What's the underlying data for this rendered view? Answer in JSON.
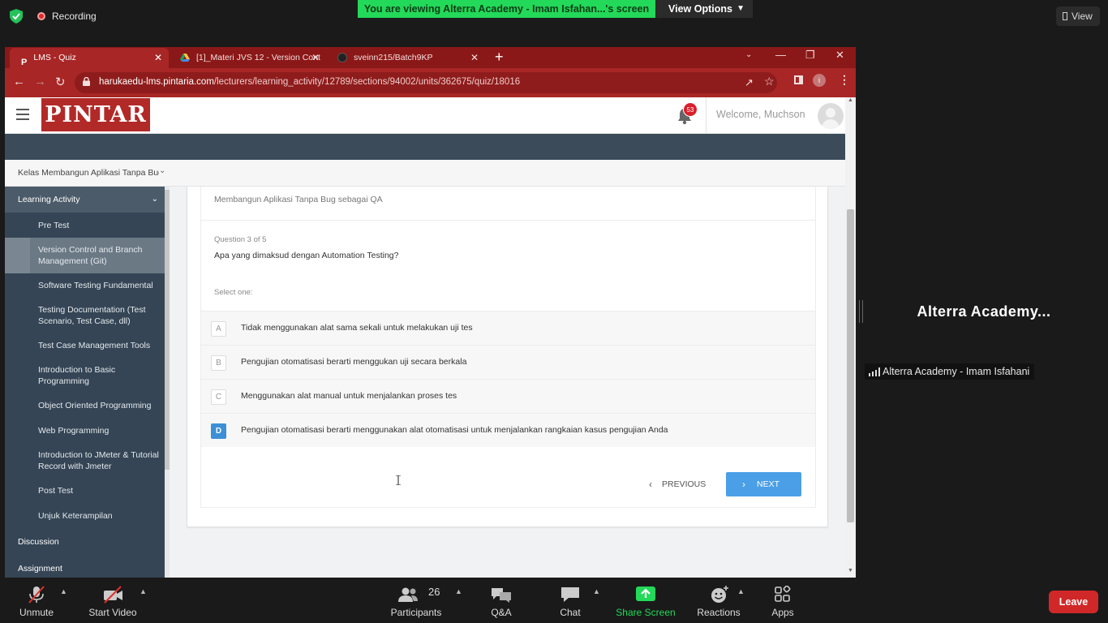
{
  "zoom_top": {
    "recording_label": "Recording",
    "viewing_banner": "You are viewing Alterra Academy - Imam Isfahan...'s screen",
    "view_options_label": "View Options",
    "view_label": "View"
  },
  "browser": {
    "tabs": [
      {
        "label": "LMS - Quiz"
      },
      {
        "label": "[1]_Materi JVS 12 - Version Cont"
      },
      {
        "label": "sveinn215/Batch9KP"
      }
    ],
    "url_host": "harukaedu-lms.pintaria.com",
    "url_path": "/lecturers/learning_activity/12789/sections/94002/units/362675/quiz/18016",
    "theme_color": "#a82626"
  },
  "header": {
    "logo_text": "PINTAR",
    "notification_count": "53",
    "welcome_text": "Welcome, Muchson"
  },
  "course": {
    "title": "Kelas Membangun Aplikasi Tanpa Bug sebagai QA"
  },
  "sidebar": {
    "section_learning_activity": "Learning Activity",
    "items": [
      {
        "label": "Pre Test"
      },
      {
        "label": "Version Control and Branch Management (Git)"
      },
      {
        "label": "Software Testing Fundamental"
      },
      {
        "label": "Testing Documentation (Test Scenario, Test Case, dll)"
      },
      {
        "label": "Test Case Management Tools"
      },
      {
        "label": "Introduction to Basic Programming"
      },
      {
        "label": "Object Oriented Programming"
      },
      {
        "label": "Web Programming"
      },
      {
        "label": "Introduction to JMeter & Tutorial Record with Jmeter"
      },
      {
        "label": "Post Test"
      },
      {
        "label": "Unjuk Keterampilan"
      }
    ],
    "section_discussion": "Discussion",
    "section_assignment": "Assignment"
  },
  "quiz": {
    "title": "Membangun Aplikasi Tanpa Bug sebagai QA",
    "question_number": "Question 3 of 5",
    "question_text": "Apa yang dimaksud dengan Automation Testing?",
    "select_one": "Select one:",
    "options": [
      {
        "letter": "A",
        "text": "Tidak menggunakan alat sama sekali untuk melakukan uji tes",
        "selected": false
      },
      {
        "letter": "B",
        "text": "Pengujian otomatisasi berarti menggukan uji secara berkala",
        "selected": false
      },
      {
        "letter": "C",
        "text": "Menggunakan alat manual untuk menjalankan proses tes",
        "selected": false
      },
      {
        "letter": "D",
        "text": "Pengujian otomatisasi berarti menggunakan alat otomatisasi untuk menjalankan rangkaian kasus pengujian Anda",
        "selected": true
      }
    ],
    "previous_label": "PREVIOUS",
    "next_label": "NEXT",
    "accent_color": "#4a9fe6"
  },
  "participant": {
    "name_big": "Alterra Academy...",
    "name_label": "Alterra Academy - Imam Isfahani"
  },
  "toolbar": {
    "unmute": "Unmute",
    "start_video": "Start Video",
    "participants": "Participants",
    "participants_count": "26",
    "qa": "Q&A",
    "chat": "Chat",
    "share_screen": "Share Screen",
    "reactions": "Reactions",
    "apps": "Apps",
    "leave": "Leave"
  }
}
